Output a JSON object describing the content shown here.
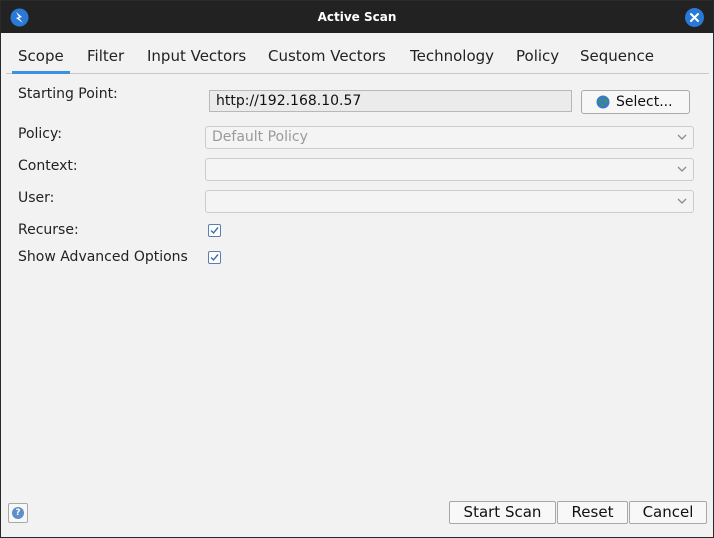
{
  "window": {
    "title": "Active Scan"
  },
  "tabs": [
    {
      "label": "Scope",
      "active": true
    },
    {
      "label": "Filter"
    },
    {
      "label": "Input Vectors"
    },
    {
      "label": "Custom Vectors"
    },
    {
      "label": "Technology"
    },
    {
      "label": "Policy"
    },
    {
      "label": "Sequence"
    }
  ],
  "form": {
    "starting_point_label": "Starting Point:",
    "starting_point_value": "http://192.168.10.57",
    "select_button_label": "Select...",
    "policy_label": "Policy:",
    "policy_value": "Default Policy",
    "context_label": "Context:",
    "context_value": "",
    "user_label": "User:",
    "user_value": "",
    "recurse_label": "Recurse:",
    "recurse_checked": true,
    "advanced_label": "Show Advanced Options",
    "advanced_checked": true
  },
  "footer": {
    "start_scan_label": "Start Scan",
    "reset_label": "Reset",
    "cancel_label": "Cancel"
  },
  "icons": {
    "app": "zap-lightning-icon",
    "close": "close-icon",
    "globe": "globe-icon",
    "dropdown": "chevron-down-icon",
    "check": "check-icon",
    "help": "help-icon"
  },
  "colors": {
    "titlebar": "#222222",
    "close_button": "#2979d9",
    "active_tab_underline": "#3d8fe0",
    "checkbox_border": "#5a7fae"
  }
}
